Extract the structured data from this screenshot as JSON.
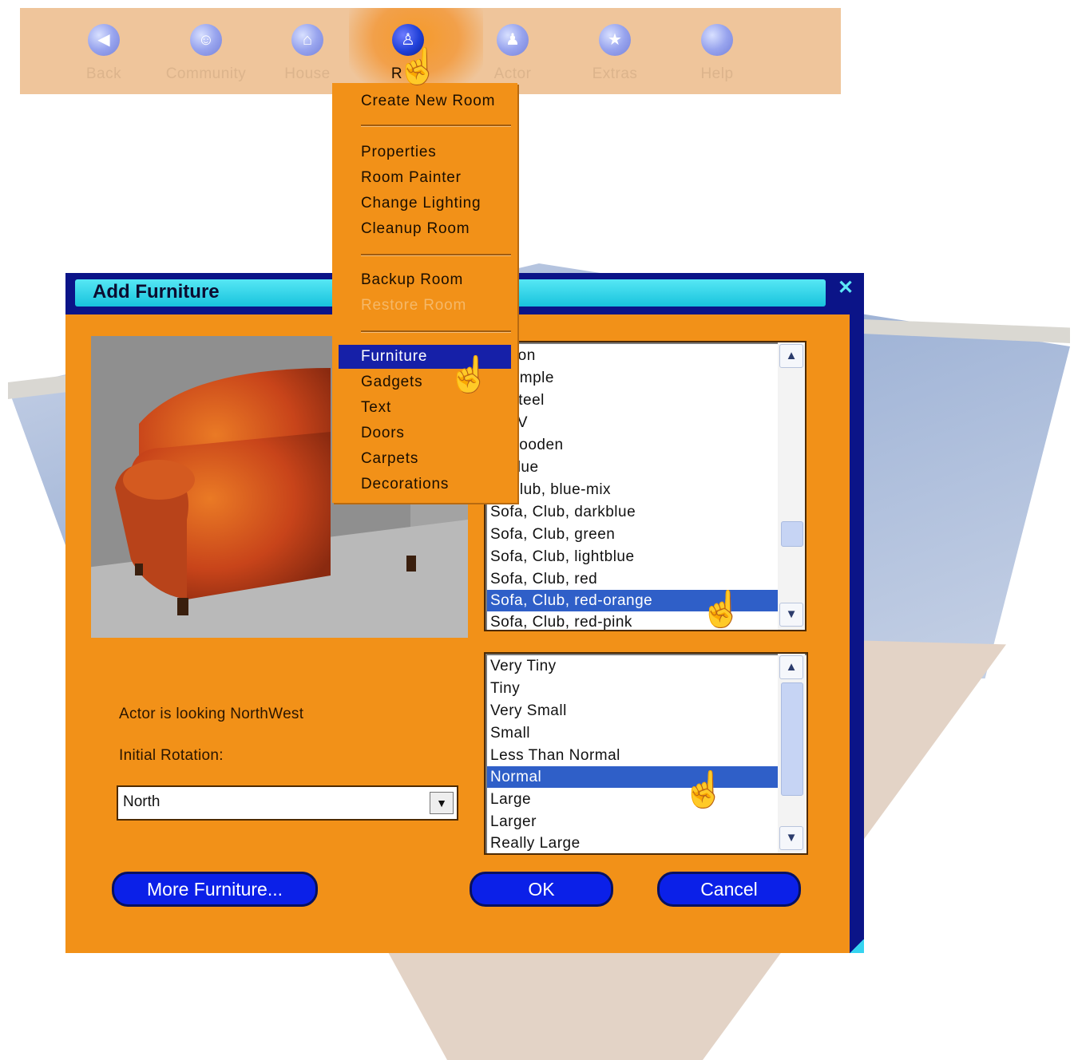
{
  "toolbar": {
    "items": [
      {
        "label": "Back",
        "icon": "back-arrow-icon"
      },
      {
        "label": "Community",
        "icon": "people-icon"
      },
      {
        "label": "House",
        "icon": "house-icon"
      },
      {
        "label": "R",
        "icon": "chair-icon"
      },
      {
        "label": "Actor",
        "icon": "person-icon"
      },
      {
        "label": "Extras",
        "icon": "star-icon"
      },
      {
        "label": "Help",
        "icon": "help-icon"
      }
    ]
  },
  "room_menu": {
    "items": [
      {
        "label": "Create New Room",
        "state": "enabled"
      },
      {
        "label": "Properties",
        "state": "enabled"
      },
      {
        "label": "Room Painter",
        "state": "enabled"
      },
      {
        "label": "Change Lighting",
        "state": "enabled"
      },
      {
        "label": "Cleanup Room",
        "state": "enabled"
      },
      {
        "label": "Backup Room",
        "state": "enabled"
      },
      {
        "label": "Restore Room",
        "state": "disabled"
      },
      {
        "label": "Furniture",
        "state": "selected"
      },
      {
        "label": "Gadgets",
        "state": "enabled"
      },
      {
        "label": "Text",
        "state": "enabled"
      },
      {
        "label": "Doors",
        "state": "enabled"
      },
      {
        "label": "Carpets",
        "state": "enabled"
      },
      {
        "label": "Decorations",
        "state": "enabled"
      }
    ]
  },
  "dialog": {
    "title": "Add Furniture",
    "close_symbol": "✕",
    "furniture_list": {
      "items": [
        "lf, Iron",
        "lf, simple",
        "lf, Steel",
        "lf, TV",
        "lf, wooden",
        "a, blue",
        "a, Club, blue-mix",
        "Sofa, Club, darkblue",
        "Sofa, Club, green",
        "Sofa, Club, lightblue",
        "Sofa, Club, red",
        "Sofa, Club, red-orange",
        "Sofa, Club, red-pink"
      ],
      "selected": "Sofa, Club, red-orange"
    },
    "size_list": {
      "items": [
        "Very Tiny",
        "Tiny",
        "Very Small",
        "Small",
        "Less Than Normal",
        "Normal",
        "Large",
        "Larger",
        "Really Large"
      ],
      "selected": "Normal"
    },
    "actor_status": "Actor is looking NorthWest",
    "rotation_label": "Initial Rotation:",
    "rotation_value": "North",
    "more_button": "More Furniture...",
    "ok_button": "OK",
    "cancel_button": "Cancel"
  }
}
